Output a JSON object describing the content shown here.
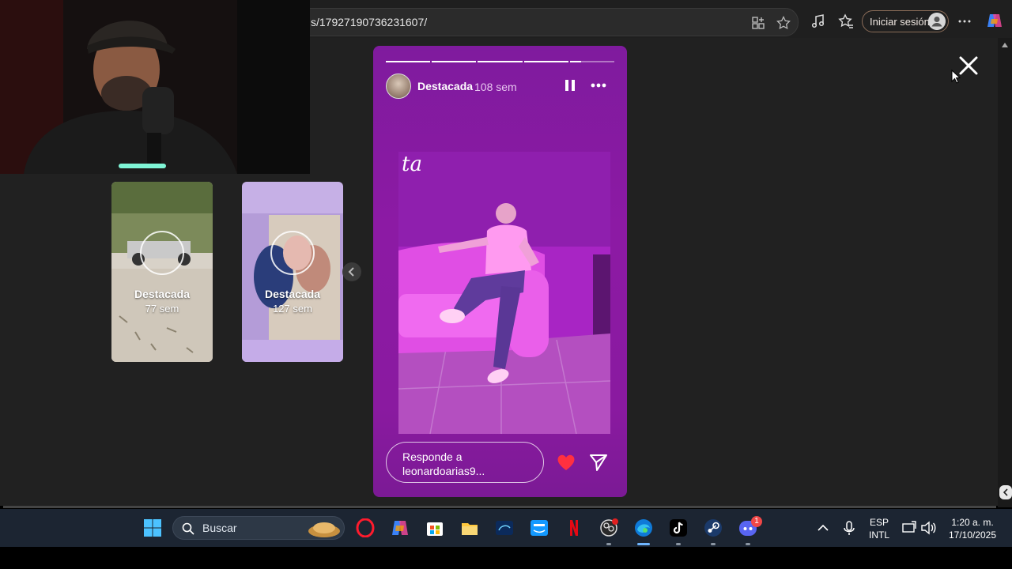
{
  "browser": {
    "address_text": "s/17927190736231607/",
    "signin_label": "Iniciar sesión"
  },
  "highlights": [
    {
      "title": "Destacada",
      "age": "77 sem"
    },
    {
      "title": "Destacada",
      "age": "127 sem"
    }
  ],
  "story": {
    "username": "Destacada",
    "age": "108 sem",
    "progress_segments": 5,
    "progress_completed": 4,
    "current_segment_fraction": 0.25,
    "photo_sign_text": "ta",
    "reply_placeholder": "Responde a leonardoarias9..."
  },
  "taskbar": {
    "search_label": "Buscar",
    "lang_top": "ESP",
    "lang_bottom": "INTL",
    "time": "1:20 a. m.",
    "date": "17/10/2025",
    "discord_badge": "1"
  },
  "colors": {
    "page_bg": "#212121",
    "story_bg": "#8c1aa4",
    "heart": "#ff3040",
    "taskbar_bg": "#1c2532"
  }
}
